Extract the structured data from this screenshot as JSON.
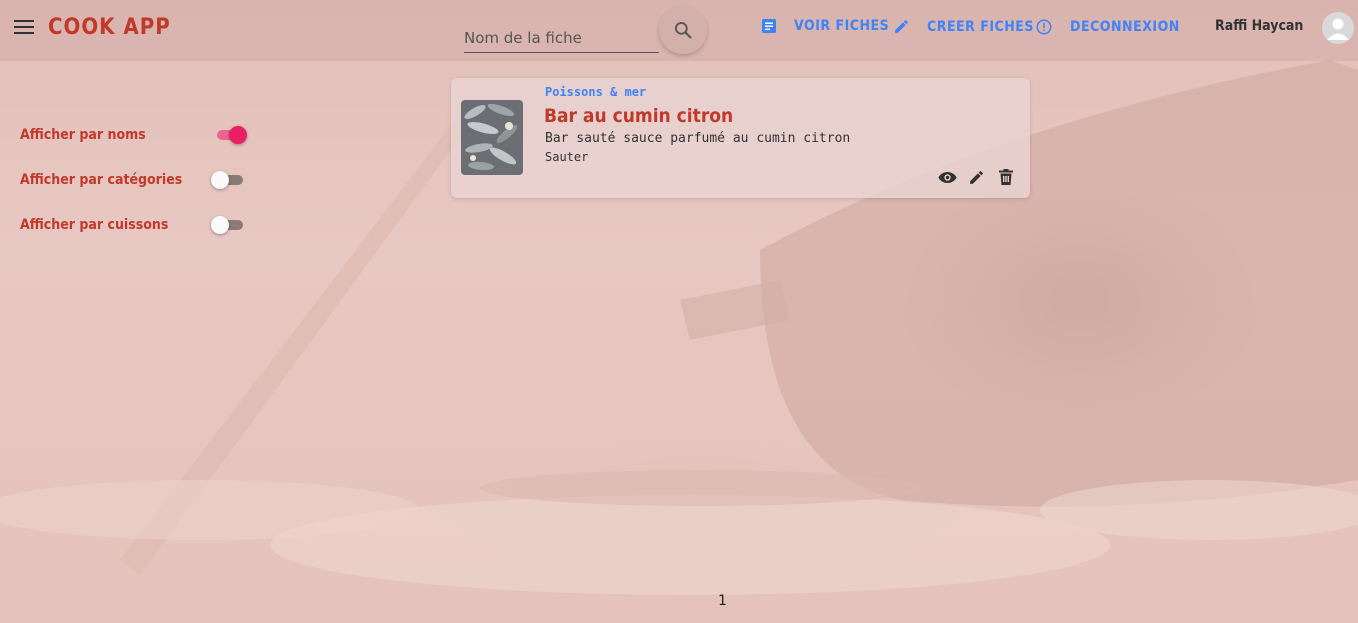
{
  "header": {
    "app_title": "COOK APP",
    "search": {
      "placeholder": "Nom de la fiche",
      "value": ""
    },
    "nav": [
      {
        "label": "VOIR FICHES",
        "icon": "document-icon"
      },
      {
        "label": "CREER FICHES",
        "icon": "pencil-icon"
      },
      {
        "label": "DECONNEXION",
        "icon": "info-icon"
      }
    ],
    "user_name": "Raffi Haycan"
  },
  "filters": [
    {
      "label": "Afficher par noms",
      "checked": true
    },
    {
      "label": "Afficher par catégories",
      "checked": false
    },
    {
      "label": "Afficher par cuissons",
      "checked": false
    }
  ],
  "cards": [
    {
      "category": "Poissons & mer",
      "title": "Bar au cumin citron",
      "description": "Bar sauté sauce parfumé au cumin citron",
      "cooking": "Sauter"
    }
  ],
  "pagination": {
    "current": "1"
  },
  "colors": {
    "accent": "#c0392b",
    "link": "#3f83f8",
    "toggle_on": "#e91e63"
  }
}
